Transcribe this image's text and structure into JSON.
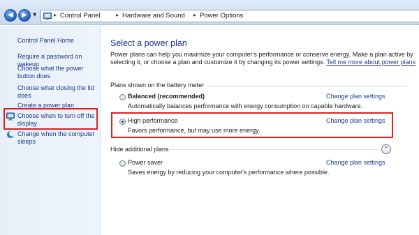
{
  "address_bar": {
    "breadcrumbs": [
      "Control Panel",
      "Hardware and Sound",
      "Power Options"
    ]
  },
  "sidebar": {
    "home": "Control Panel Home",
    "items": [
      {
        "label": "Require a password on wakeup"
      },
      {
        "label": "Choose what the power button does"
      },
      {
        "label": "Choose what closing the lid does"
      },
      {
        "label": "Create a power plan"
      },
      {
        "label": "Choose when to turn off the display",
        "icon": "monitor-icon"
      },
      {
        "label": "Change when the computer sleeps",
        "icon": "moon-icon"
      }
    ]
  },
  "main": {
    "title": "Select a power plan",
    "intro_text": "Power plans can help you maximize your computer's performance or conserve energy. Make a plan active by selecting it, or choose a plan and customize it by changing its power settings.",
    "intro_link": "Tell me more about power plans",
    "section_battery": "Plans shown on the battery meter",
    "section_additional": "Hide additional plans",
    "change_label": "Change plan settings",
    "plans": [
      {
        "name": "Balanced (recommended)",
        "description": "Automatically balances performance with energy consumption on capable hardware.",
        "selected": false
      },
      {
        "name": "High performance",
        "description": "Favors performance, but may use more energy.",
        "selected": true
      },
      {
        "name": "Power saver",
        "description": "Saves energy by reducing your computer's performance where possible.",
        "selected": false
      }
    ]
  },
  "colors": {
    "link": "#1b3b8b",
    "title": "#1e3287",
    "highlight": "#e02020",
    "sidebar_bg": "#e7eff9"
  }
}
